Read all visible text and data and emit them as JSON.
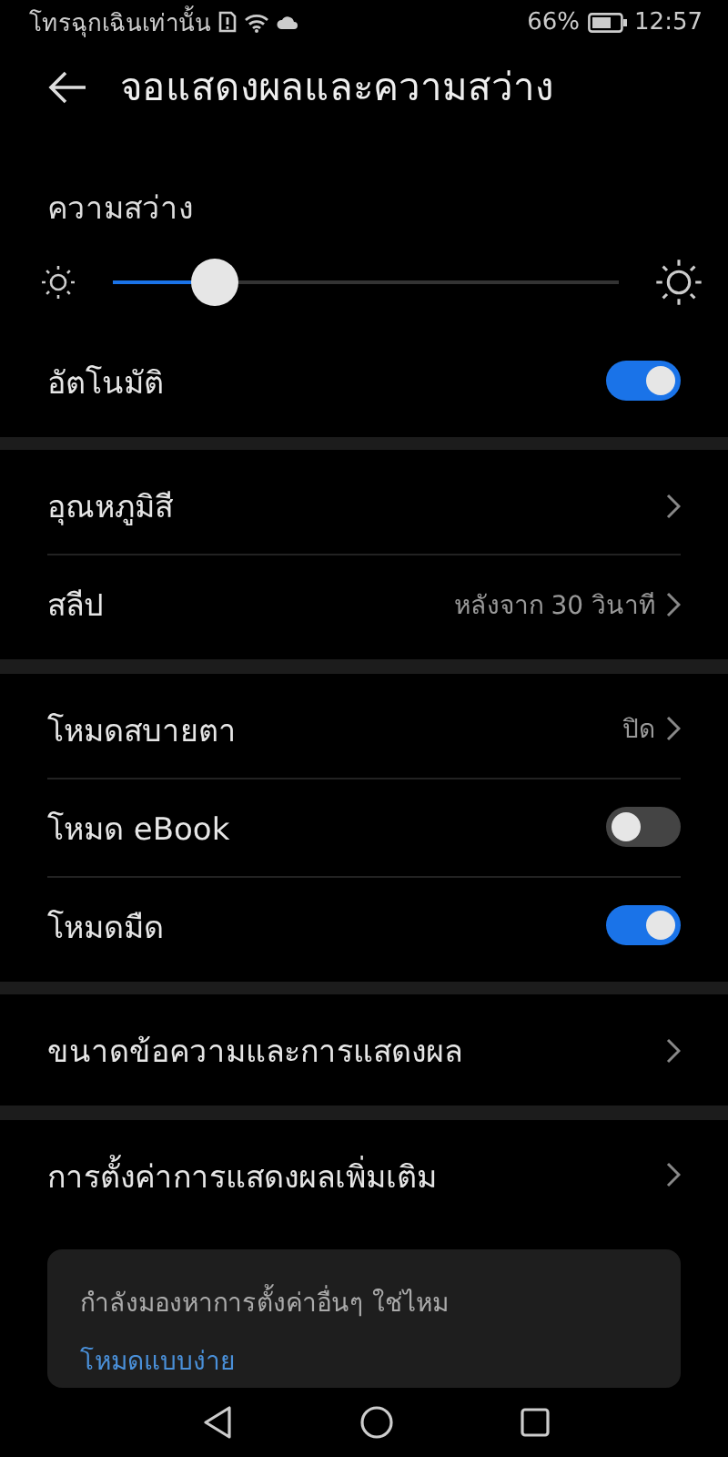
{
  "status_bar": {
    "carrier": "โทรฉุกเฉินเท่านั้น",
    "battery": "66%",
    "time": "12:57"
  },
  "header": {
    "title": "จอแสดงผลและความสว่าง"
  },
  "brightness": {
    "label": "ความสว่าง",
    "level": 0.2
  },
  "auto": {
    "label": "อัตโนมัติ",
    "on": true
  },
  "groups": [
    [
      {
        "kind": "chevron",
        "label": "อุณหภูมิสี"
      },
      {
        "kind": "chevron",
        "label": "สลีป",
        "value": "หลังจาก 30 วินาที"
      }
    ],
    [
      {
        "kind": "chevron",
        "label": "โหมดสบายตา",
        "value": "ปิด"
      },
      {
        "kind": "toggle",
        "label": "โหมด eBook",
        "on": false
      },
      {
        "kind": "toggle",
        "label": "โหมดมืด",
        "on": true
      }
    ],
    [
      {
        "kind": "chevron",
        "label": "ขนาดข้อความและการแสดงผล"
      }
    ],
    [
      {
        "kind": "chevron",
        "label": "การตั้งค่าการแสดงผลเพิ่มเติม"
      }
    ]
  ],
  "suggestion": {
    "text": "กำลังมองหาการตั้งค่าอื่นๆ ใช่ไหม",
    "link": "โหมดแบบง่าย"
  }
}
